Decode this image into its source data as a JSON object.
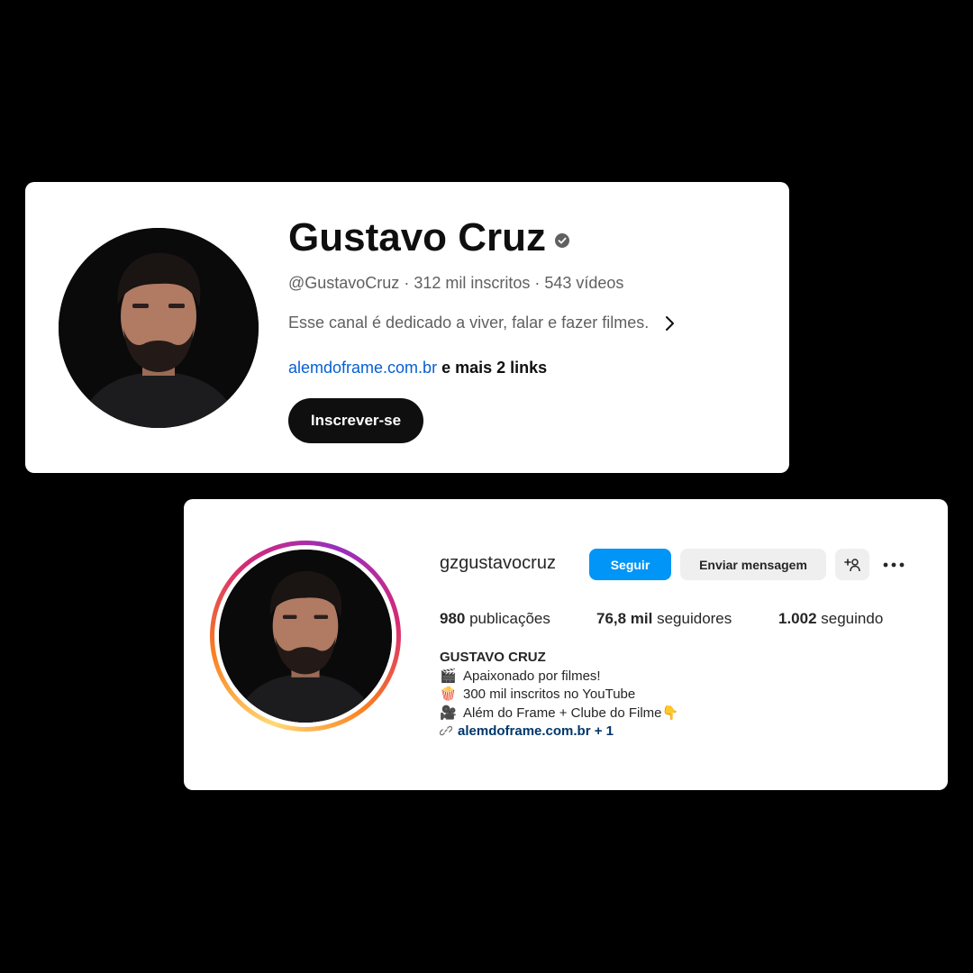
{
  "youtube": {
    "channel_name": "Gustavo Cruz",
    "handle": "@GustavoCruz",
    "subscribers": "312 mil inscritos",
    "videos": "543 vídeos",
    "separator": " · ",
    "description": "Esse canal é dedicado a viver, falar e fazer filmes.",
    "link_text": "alemdoframe.com.br",
    "more_links": " e mais 2 links",
    "subscribe_label": "Inscrever-se"
  },
  "instagram": {
    "username": "gzgustavocruz",
    "follow_label": "Seguir",
    "message_label": "Enviar mensagem",
    "stats": {
      "posts_count": "980",
      "posts_label": " publicações",
      "followers_count": "76,8 mil",
      "followers_label": " seguidores",
      "following_count": "1.002",
      "following_label": " seguindo"
    },
    "bio": {
      "name": "GUSTAVO CRUZ",
      "lines": [
        {
          "emoji": "🎬",
          "text": "Apaixonado por filmes!"
        },
        {
          "emoji": "🍿",
          "text": "300 mil inscritos no YouTube"
        },
        {
          "emoji": "🎥",
          "text": "Além do Frame + Clube do Filme👇"
        }
      ],
      "link_text": "alemdoframe.com.br",
      "link_extra": " + 1"
    }
  },
  "colors": {
    "youtube_link": "#065fd4",
    "instagram_follow": "#0095f6",
    "instagram_link": "#00376b"
  },
  "icons": {
    "verified": "verified-badge-icon",
    "chevron": "chevron-right-icon",
    "add_person": "add-person-icon",
    "more": "more-options-icon",
    "link": "link-icon"
  }
}
